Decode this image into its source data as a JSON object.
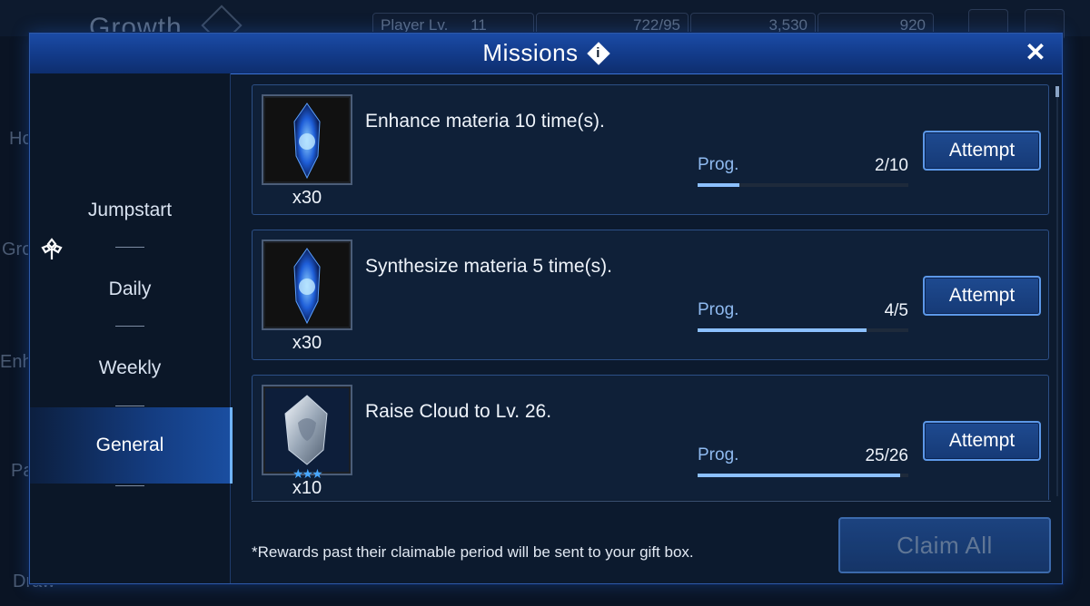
{
  "background": {
    "title": "Growth",
    "player_level_label": "Player Lv.",
    "player_level_value": "11",
    "stamina": "722/95",
    "crystals": "3,530",
    "gems": "920",
    "side_labels": [
      "Ho",
      "Gro",
      "Enh",
      "Pa",
      "Draw"
    ]
  },
  "modal": {
    "title": "Missions",
    "info_glyph": "i",
    "close_glyph": "✕"
  },
  "sidebar": {
    "items": [
      {
        "label": "Jumpstart"
      },
      {
        "label": "Daily"
      },
      {
        "label": "Weekly"
      },
      {
        "label": "General"
      }
    ],
    "active": "General"
  },
  "missions": [
    {
      "description": "Enhance materia 10 time(s).",
      "reward_qty": "x30",
      "reward_icon": "blue-materia-crystal-icon",
      "prog_label": "Prog.",
      "progress_text": "2/10",
      "progress_fraction": 0.2,
      "button": "Attempt"
    },
    {
      "description": "Synthesize materia 5 time(s).",
      "reward_qty": "x30",
      "reward_icon": "blue-materia-crystal-icon",
      "prog_label": "Prog.",
      "progress_text": "4/5",
      "progress_fraction": 0.8,
      "button": "Attempt"
    },
    {
      "description": "Raise Cloud to Lv. 26.",
      "reward_qty": "x10",
      "reward_icon": "silver-weapon-crystal-icon",
      "reward_stars": "★★★",
      "prog_label": "Prog.",
      "progress_text": "25/26",
      "progress_fraction": 0.96,
      "button": "Attempt"
    }
  ],
  "footer": {
    "note": "*Rewards past their claimable period will be sent to your gift box.",
    "claim_all": "Claim All"
  },
  "colors": {
    "accent": "#2e5aa8",
    "progress": "#8cc0ff",
    "header": "#1b4ba6"
  }
}
